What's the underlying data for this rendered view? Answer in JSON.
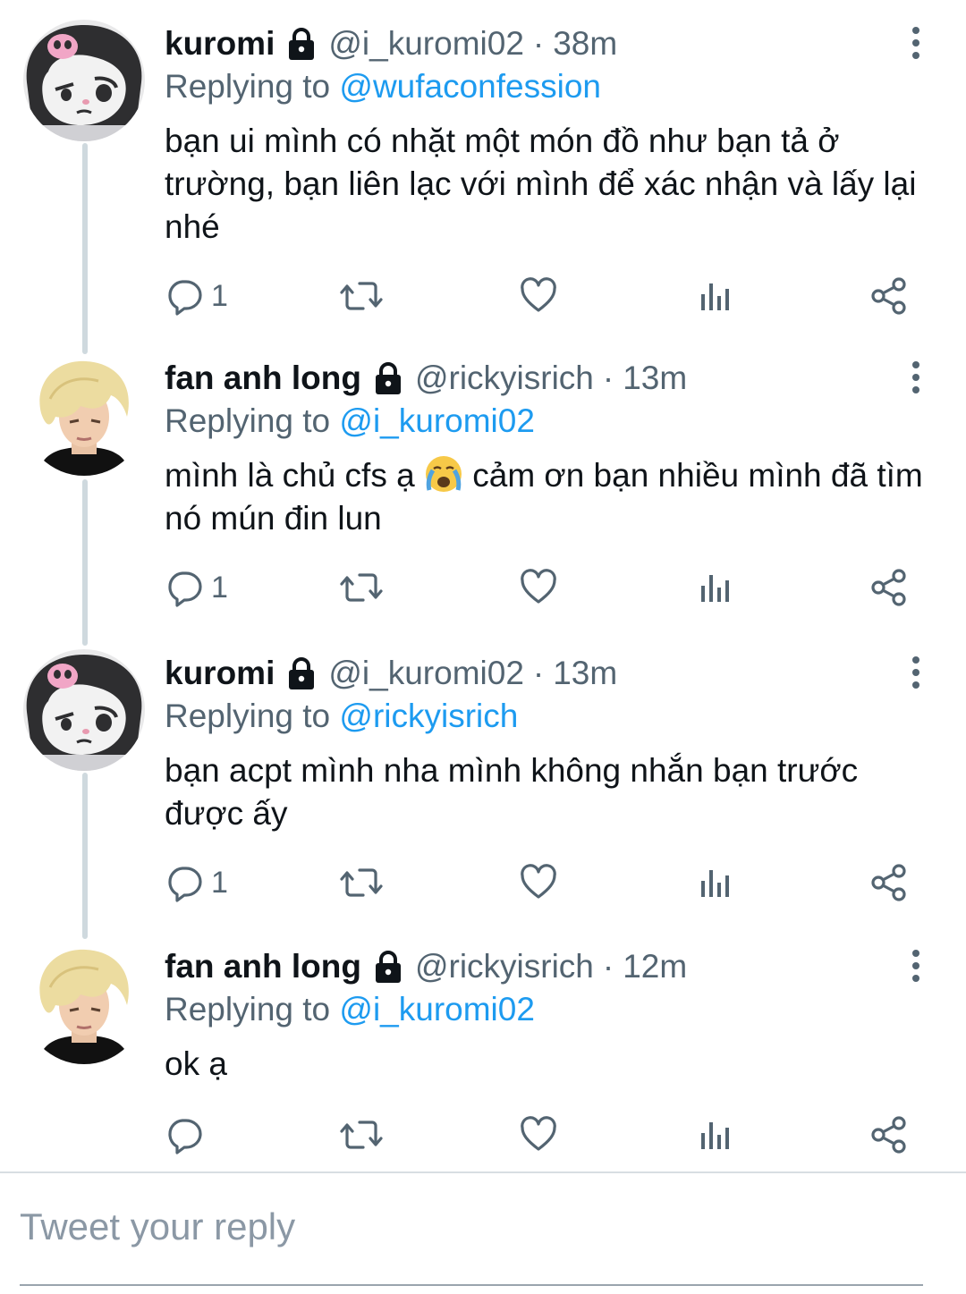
{
  "colors": {
    "name": "#0f1419",
    "secondary": "#536471",
    "link": "#1d9bf0",
    "thread_line": "#cfd9de"
  },
  "tweets": [
    {
      "author": "kuromi",
      "handle": "@i_kuromi02",
      "separator": "·",
      "time": "38m",
      "reply_prefix": "Replying to",
      "reply_to": "@wufaconfession",
      "text": "bạn ui mình có nhặt một món đồ như bạn tả ở trường, bạn liên lạc với mình để xác nhận và lấy lại nhé",
      "reply_count": "1",
      "avatar": "kuromi-avatar"
    },
    {
      "author": "fan anh long",
      "handle": "@rickyisrich",
      "separator": "·",
      "time": "13m",
      "reply_prefix": "Replying to",
      "reply_to": "@i_kuromi02",
      "text_before_emoji": "mình là chủ cfs ạ",
      "emoji": "loudly-crying-face",
      "text_after_emoji": "cảm ơn bạn nhiều mình đã tìm nó mún đin lun",
      "reply_count": "1",
      "avatar": "blond-person-avatar"
    },
    {
      "author": "kuromi",
      "handle": "@i_kuromi02",
      "separator": "·",
      "time": "13m",
      "reply_prefix": "Replying to",
      "reply_to": "@rickyisrich",
      "text": "bạn acpt mình nha mình không nhắn bạn trước được ấy",
      "reply_count": "1",
      "avatar": "kuromi-avatar"
    },
    {
      "author": "fan anh long",
      "handle": "@rickyisrich",
      "separator": "·",
      "time": "12m",
      "reply_prefix": "Replying to",
      "reply_to": "@i_kuromi02",
      "text": "ok ạ",
      "reply_count": "",
      "avatar": "blond-person-avatar"
    }
  ],
  "compose": {
    "placeholder": "Tweet your reply"
  }
}
